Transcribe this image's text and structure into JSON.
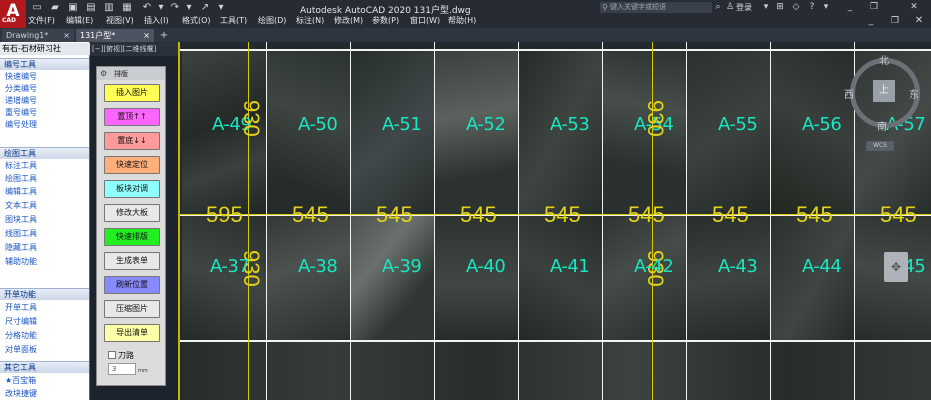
{
  "app": {
    "logo_letter": "A",
    "logo_sub": "CAD",
    "title": "Autodesk AutoCAD 2020    131户型.dwg",
    "search_placeholder": "键入关键字或短语",
    "login": "登录"
  },
  "menu": [
    "文件(F)",
    "编辑(E)",
    "视图(V)",
    "插入(I)",
    "格式(O)",
    "工具(T)",
    "绘图(D)",
    "标注(N)",
    "修改(M)",
    "参数(P)",
    "窗口(W)",
    "帮助(H)"
  ],
  "tabs": [
    {
      "label": "Drawing1*",
      "close": "×"
    },
    {
      "label": "131户型*",
      "close": "×"
    }
  ],
  "tab_add": "+",
  "left_panel": {
    "title": "有石-石材研习社",
    "sections": [
      {
        "header": "编号工具",
        "items": [
          "快速编号",
          "分类编号",
          "递增编号",
          "重号编号",
          "编号处理"
        ]
      },
      {
        "header": "绘图工具",
        "items": [
          "标注工具",
          "绘图工具",
          "编辑工具",
          "文本工具",
          "图块工具",
          "线图工具",
          "隐藏工具",
          "辅助功能"
        ]
      },
      {
        "header": "开单功能",
        "items": [
          "开单工具",
          "尺寸编辑",
          "分格功能",
          "对单面板"
        ]
      },
      {
        "header": "其它工具",
        "items": [
          "★百宝箱",
          "改块捷键"
        ]
      }
    ]
  },
  "strip": {
    "label": "[−][俯视][二维线框]",
    "close": "×"
  },
  "palette": {
    "title": "排版",
    "buttons": [
      {
        "label": "插入图片",
        "color": "#ffff55"
      },
      {
        "label": "置顶↑↑",
        "color": "#ff66ff"
      },
      {
        "label": "置底↓↓",
        "color": "#ff9a9a"
      },
      {
        "label": "快速定位",
        "color": "#ffb07a"
      },
      {
        "label": "板块对调",
        "color": "#8fffff"
      },
      {
        "label": "修改大板",
        "color": "#e8e8e8"
      },
      {
        "label": "快速排版",
        "color": "#22ee22"
      },
      {
        "label": "生成表单",
        "color": "#e8e8e8"
      },
      {
        "label": "刷新位置",
        "color": "#8a8aff"
      },
      {
        "label": "压缩图片",
        "color": "#e8e8e8"
      },
      {
        "label": "导出清单",
        "color": "#ffffaa"
      }
    ],
    "cut_label": "刀路",
    "cut_value": "3",
    "cut_unit": "mm"
  },
  "canvas": {
    "row1_labels": [
      "A-49",
      "A-50",
      "A-51",
      "A-52",
      "A-53",
      "A-54",
      "A-55",
      "A-56",
      "A-57"
    ],
    "row2_labels": [
      "A-37",
      "A-38",
      "A-39",
      "A-40",
      "A-41",
      "A-42",
      "A-43",
      "A-44",
      "A-45"
    ],
    "h_dims": [
      "595",
      "545",
      "545",
      "545",
      "545",
      "545",
      "545",
      "545",
      "545"
    ],
    "v_dims": [
      "930",
      "930",
      "930",
      "930"
    ]
  },
  "viewcube": {
    "top_face": "上",
    "north": "北",
    "south": "南",
    "east": "东",
    "west": "西",
    "wcs": "WCS"
  }
}
